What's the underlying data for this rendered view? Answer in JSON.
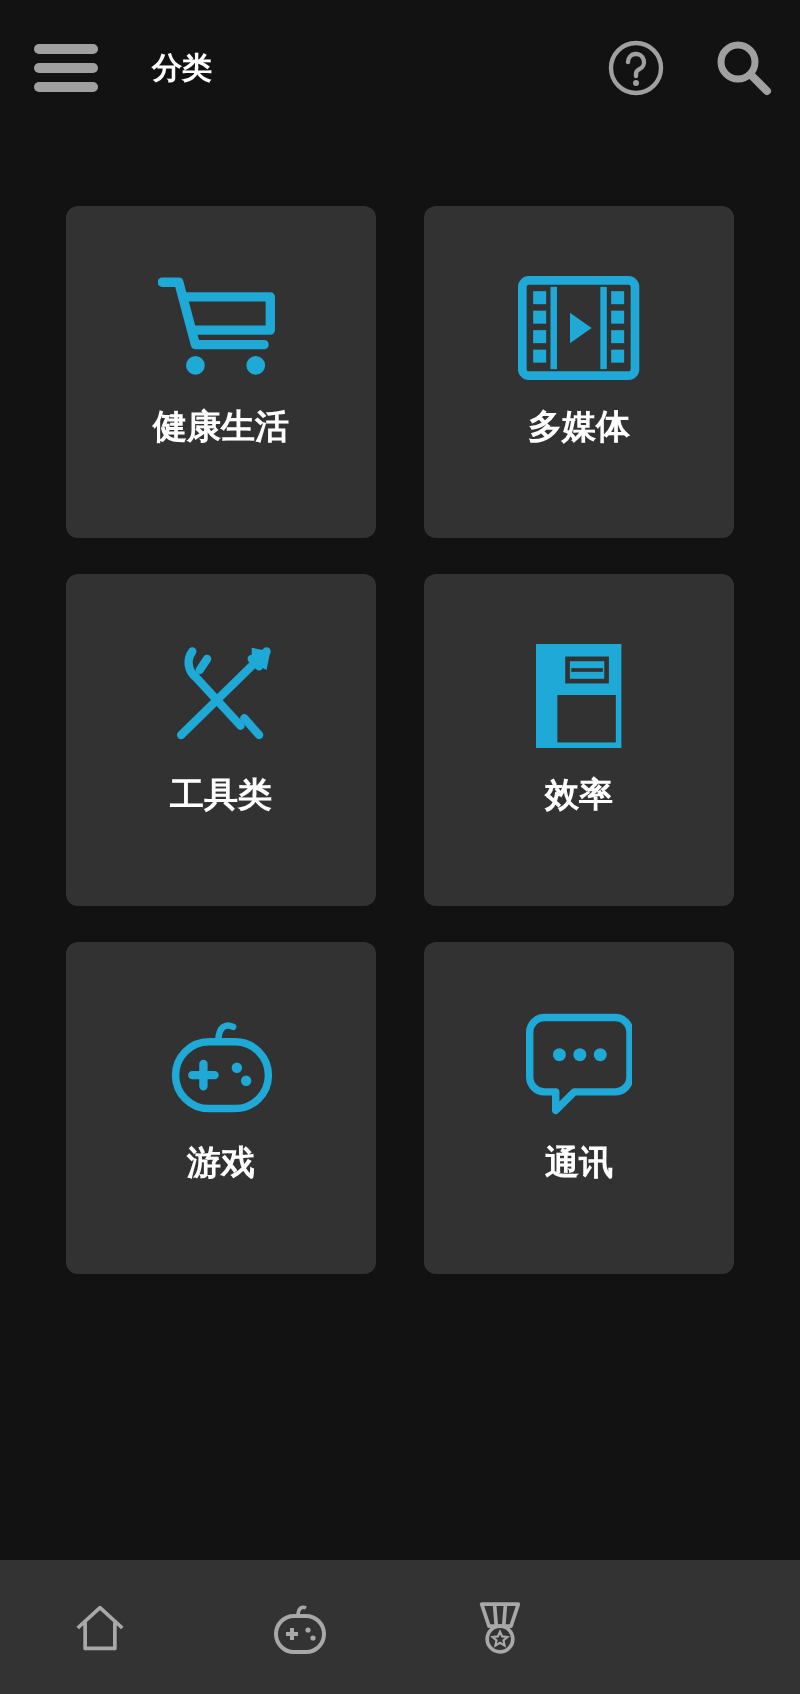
{
  "header": {
    "title": "分类"
  },
  "categories": [
    {
      "kind": "cart",
      "label": "健康生活"
    },
    {
      "kind": "film",
      "label": "多媒体"
    },
    {
      "kind": "tools",
      "label": "工具类"
    },
    {
      "kind": "notebook",
      "label": "效率"
    },
    {
      "kind": "gamepad",
      "label": "游戏"
    },
    {
      "kind": "chat",
      "label": "通讯"
    }
  ],
  "bottom_nav": [
    {
      "kind": "home"
    },
    {
      "kind": "gamepad"
    },
    {
      "kind": "medal"
    }
  ]
}
